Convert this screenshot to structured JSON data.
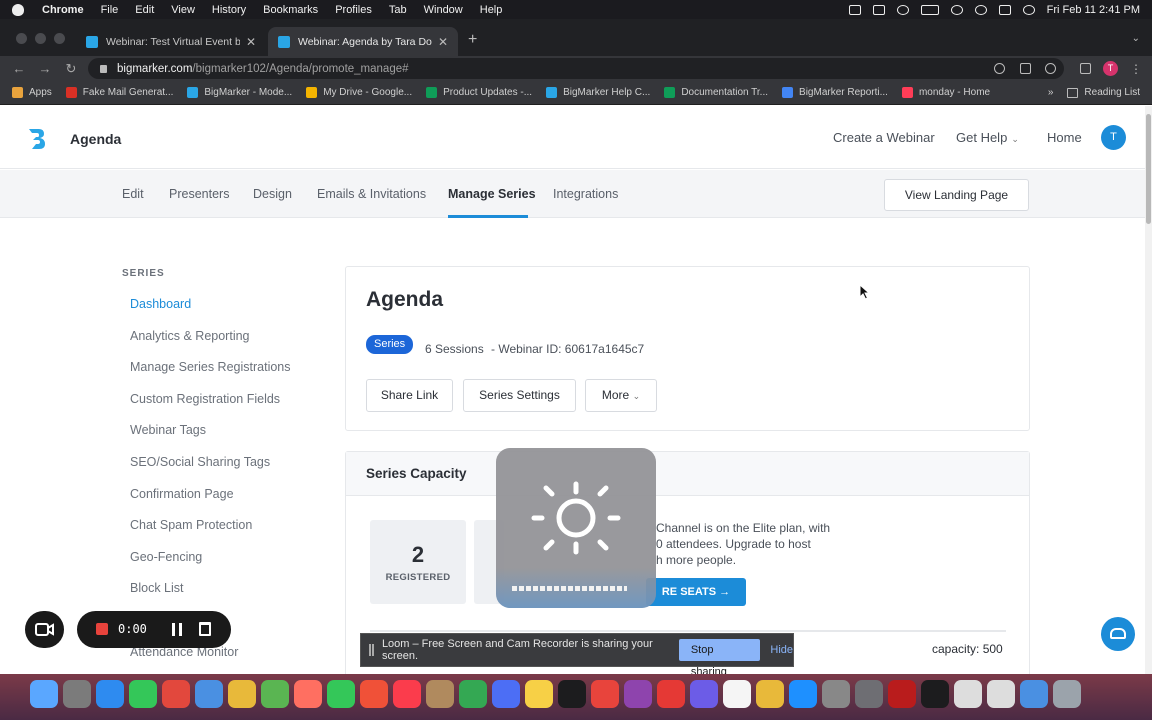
{
  "menubar": {
    "app": "Chrome",
    "items": [
      "File",
      "Edit",
      "View",
      "History",
      "Bookmarks",
      "Profiles",
      "Tab",
      "Window",
      "Help"
    ],
    "clock": "Fri Feb 11  2:41 PM"
  },
  "browser": {
    "tabs": [
      {
        "title": "Webinar: Test Virtual Event by",
        "active": false
      },
      {
        "title": "Webinar: Agenda by Tara Dove",
        "active": true
      }
    ],
    "url_host": "bigmarker.com",
    "url_path": "/bigmarker102/Agenda/promote_manage#",
    "profile_initial": "T",
    "bookmarks": [
      {
        "label": "Apps",
        "color": "#e8a33d"
      },
      {
        "label": "Fake Mail Generat...",
        "color": "#d93025"
      },
      {
        "label": "BigMarker - Mode...",
        "color": "#2aa6e6"
      },
      {
        "label": "My Drive - Google...",
        "color": "#f4b400"
      },
      {
        "label": "Product Updates -...",
        "color": "#0f9d58"
      },
      {
        "label": "BigMarker Help C...",
        "color": "#2aa6e6"
      },
      {
        "label": "Documentation Tr...",
        "color": "#0f9d58"
      },
      {
        "label": "BigMarker Reporti...",
        "color": "#4285f4"
      },
      {
        "label": "monday - Home",
        "color": "#ff3d57"
      }
    ],
    "more": "»",
    "reading_list": "Reading List"
  },
  "header": {
    "title": "Agenda",
    "create_webinar": "Create a Webinar",
    "get_help": "Get Help",
    "home": "Home",
    "user_initial": "T"
  },
  "subnav": {
    "tabs": [
      "Edit",
      "Presenters",
      "Design",
      "Emails & Invitations",
      "Manage Series",
      "Integrations"
    ],
    "active_tab": "Manage Series",
    "view_landing": "View Landing Page"
  },
  "sidebar": {
    "title": "SERIES",
    "items": [
      "Dashboard",
      "Analytics & Reporting",
      "Manage Series Registrations",
      "Custom Registration Fields",
      "Webinar Tags",
      "SEO/Social Sharing Tags",
      "Confirmation Page",
      "Chat Spam Protection",
      "Geo-Fencing",
      "Block List",
      "Attendance Monitor"
    ],
    "active_item": "Dashboard"
  },
  "main": {
    "title": "Agenda",
    "badge": "Series",
    "sessions": "6 Sessions",
    "webinar_id": "- Webinar ID: 60617a1645c7",
    "share_link": "Share Link",
    "series_settings": "Series Settings",
    "more": "More"
  },
  "capacity": {
    "title": "Series Capacity",
    "registered_count": "2",
    "registered_label": "REGISTERED",
    "text": "Channel is on the Elite plan, with\n0 attendees. Upgrade to host\nh more people.",
    "seats_button": "RE SEATS →",
    "capacity_label": "capacity: 500"
  },
  "loom": {
    "time": "0:00",
    "banner_text": "Loom – Free Screen and Cam Recorder is sharing your screen.",
    "stop_sharing": "Stop sharing",
    "hide": "Hide"
  },
  "hud": {
    "brightness_level": 0.9
  },
  "colors": {
    "accent": "#1c8cd8",
    "badge": "#1c66d8",
    "loom_record": "#e8433c"
  }
}
